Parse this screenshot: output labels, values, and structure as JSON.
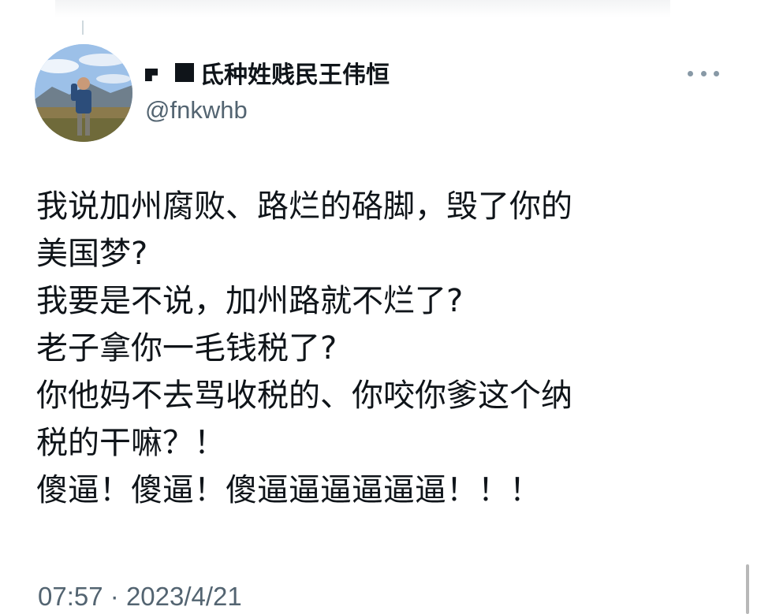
{
  "author": {
    "display_name": "氐种姓贱民王伟恒",
    "handle": "@fnkwhb"
  },
  "icons": {
    "avatar": "avatar-photo",
    "flag": "flag-icon",
    "block": "block-icon",
    "more": "more-icon"
  },
  "tweet": {
    "lines": [
      "我说加州腐败、路烂的硌脚，毁了你的",
      "美国梦?",
      "我要是不说，加州路就不烂了?",
      "老子拿你一毛钱税了?",
      "你他妈不去骂收税的、你咬你爹这个纳",
      "税的干嘛？！",
      "傻逼！傻逼！傻逼逼逼逼逼逼！！！"
    ]
  },
  "meta": {
    "time": "07:57",
    "separator": "·",
    "date": "2023/4/21"
  },
  "colors": {
    "text_primary": "#0f1419",
    "text_secondary": "#536471",
    "background": "#ffffff"
  }
}
